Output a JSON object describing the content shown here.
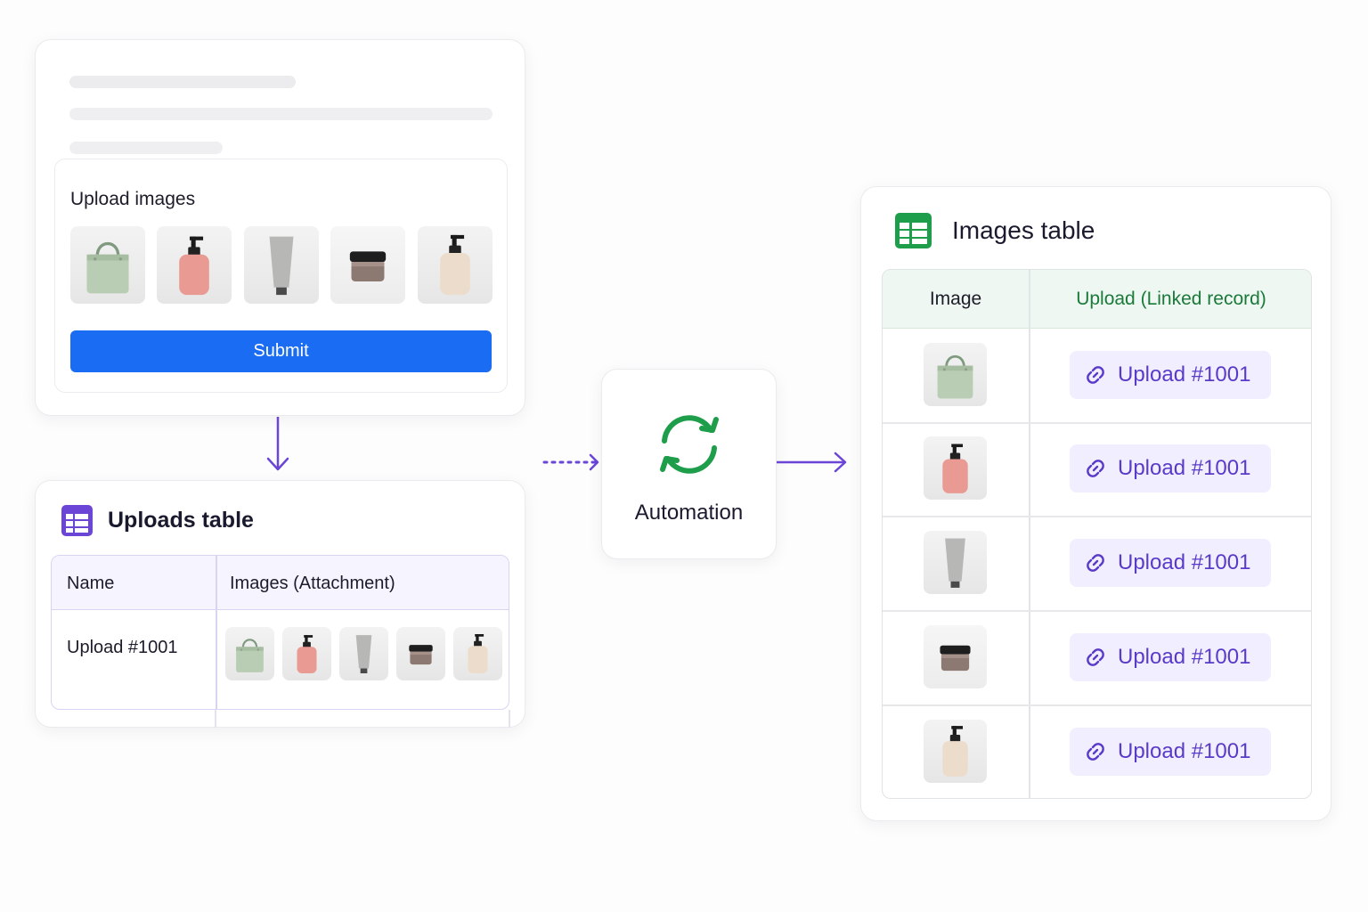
{
  "form": {
    "upload_label": "Upload images",
    "submit_label": "Submit"
  },
  "uploads_table": {
    "title": "Uploads table",
    "columns": [
      "Name",
      "Images (Attachment)"
    ],
    "rows": [
      {
        "name": "Upload #1001",
        "images": [
          "bag",
          "pink-pump-bottle",
          "gray-tube",
          "brown-jar",
          "cream-pump-bottle"
        ]
      }
    ]
  },
  "automation": {
    "label": "Automation",
    "icon": "sync-icon"
  },
  "images_table": {
    "title": "Images table",
    "columns": [
      "Image",
      "Upload (Linked record)"
    ],
    "rows": [
      {
        "image": "bag",
        "link": "Upload #1001"
      },
      {
        "image": "pink-pump-bottle",
        "link": "Upload #1001"
      },
      {
        "image": "gray-tube",
        "link": "Upload #1001"
      },
      {
        "image": "brown-jar",
        "link": "Upload #1001"
      },
      {
        "image": "cream-pump-bottle",
        "link": "Upload #1001"
      }
    ]
  },
  "colors": {
    "submit": "#1a6cf2",
    "uploads_accent": "#6a45d6",
    "images_accent": "#1e9e4a",
    "link_text": "#5a3ac8",
    "arrow": "#6a45d6"
  }
}
